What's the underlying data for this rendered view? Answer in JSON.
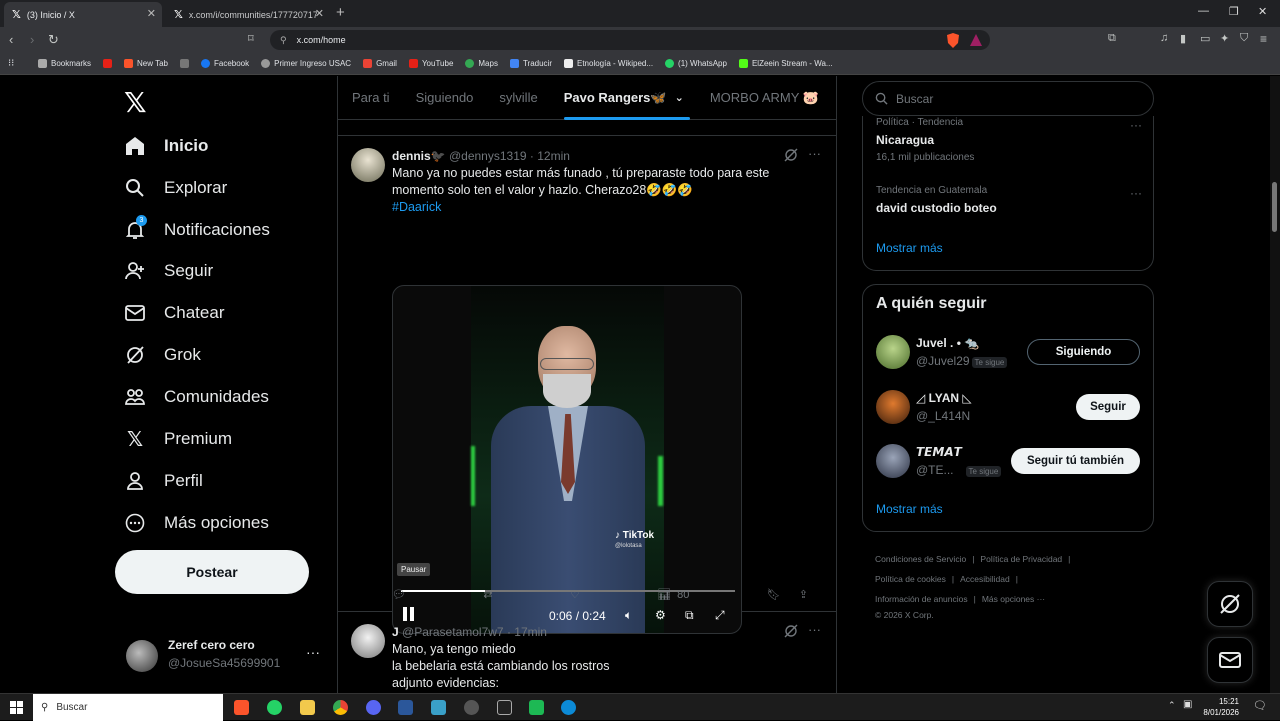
{
  "browser": {
    "tabs": [
      {
        "label": "(3) Inicio / X"
      },
      {
        "label": "x.com/i/communities/17772071704..."
      }
    ],
    "url": "x.com/home",
    "bookmarks": [
      "Bookmarks",
      "New Tab",
      "Facebook",
      "Primer Ingreso USAC",
      "Gmail",
      "YouTube",
      "Maps",
      "Traducir",
      "Etnología - Wikiped...",
      "(1) WhatsApp",
      "ElZeein Stream - Wa..."
    ]
  },
  "nav": {
    "items": [
      {
        "label": "Inicio"
      },
      {
        "label": "Explorar"
      },
      {
        "label": "Notificaciones",
        "badge": "3"
      },
      {
        "label": "Seguir"
      },
      {
        "label": "Chatear"
      },
      {
        "label": "Grok"
      },
      {
        "label": "Comunidades"
      },
      {
        "label": "Premium"
      },
      {
        "label": "Perfil"
      },
      {
        "label": "Más opciones"
      }
    ],
    "post_label": "Postear",
    "account": {
      "name": "Zeref cero cero",
      "handle": "@JosueSa45699901"
    }
  },
  "feed": {
    "tabs": [
      "Para ti",
      "Siguiendo",
      "sylville",
      "Pavo Rangers🦋",
      "MORBO ARMY 🐷"
    ],
    "tweet1": {
      "name": "dennis🐦‍⬛",
      "handle": "@dennys1319",
      "time": "· 12min",
      "text": "Mano ya no puedes estar más funado , tú preparaste todo para este momento solo ten el valor y hazlo. Cherazo28🤣🤣🤣",
      "hashtag": "#Daarick",
      "video": {
        "tooltip": "Pausar",
        "time": "0:06 / 0:24",
        "progress": 0.25,
        "watermark": "TikTok",
        "watermark_handle": "@lolotasa"
      },
      "views": "80"
    },
    "tweet2": {
      "name": "J",
      "handle": "@Parasetamol7w7",
      "time": "· 17min",
      "lines": [
        "Mano, ya tengo miedo",
        "la bebelaria está cambiando los rostros",
        "adjunto evidencias:"
      ]
    }
  },
  "sidebar": {
    "search_placeholder": "Buscar",
    "trends": [
      {
        "category": "Política · Tendencia",
        "name": "Nicaragua",
        "count": "16,1 mil publicaciones"
      },
      {
        "category": "Tendencia en Guatemala",
        "name": "david custodio boteo"
      }
    ],
    "show_more": "Mostrar más",
    "who_to_follow": {
      "title": "A quién seguir",
      "users": [
        {
          "name": "Juvel . • 🐀",
          "handle": "@Juvel29",
          "follows_you": "Te sigue",
          "button": "Siguiendo"
        },
        {
          "name": "◿ LYAN ◺",
          "handle": "@_L414N",
          "button": "Seguir"
        },
        {
          "name": "𝙏𝙀𝙈𝘼𝙏",
          "handle": "@TE...",
          "follows_you": "Te sigue",
          "button": "Seguir tú también"
        }
      ],
      "show_more": "Mostrar más"
    },
    "footer": [
      "Condiciones de Servicio",
      "|",
      "Política de Privacidad",
      "|",
      "Política de cookies",
      "|",
      "Accesibilidad",
      "|",
      "Información de anuncios",
      "|",
      "Más opciones ···",
      "© 2026 X Corp."
    ]
  },
  "taskbar": {
    "search": "Buscar",
    "time": "15:21",
    "date": "8/01/2026"
  }
}
